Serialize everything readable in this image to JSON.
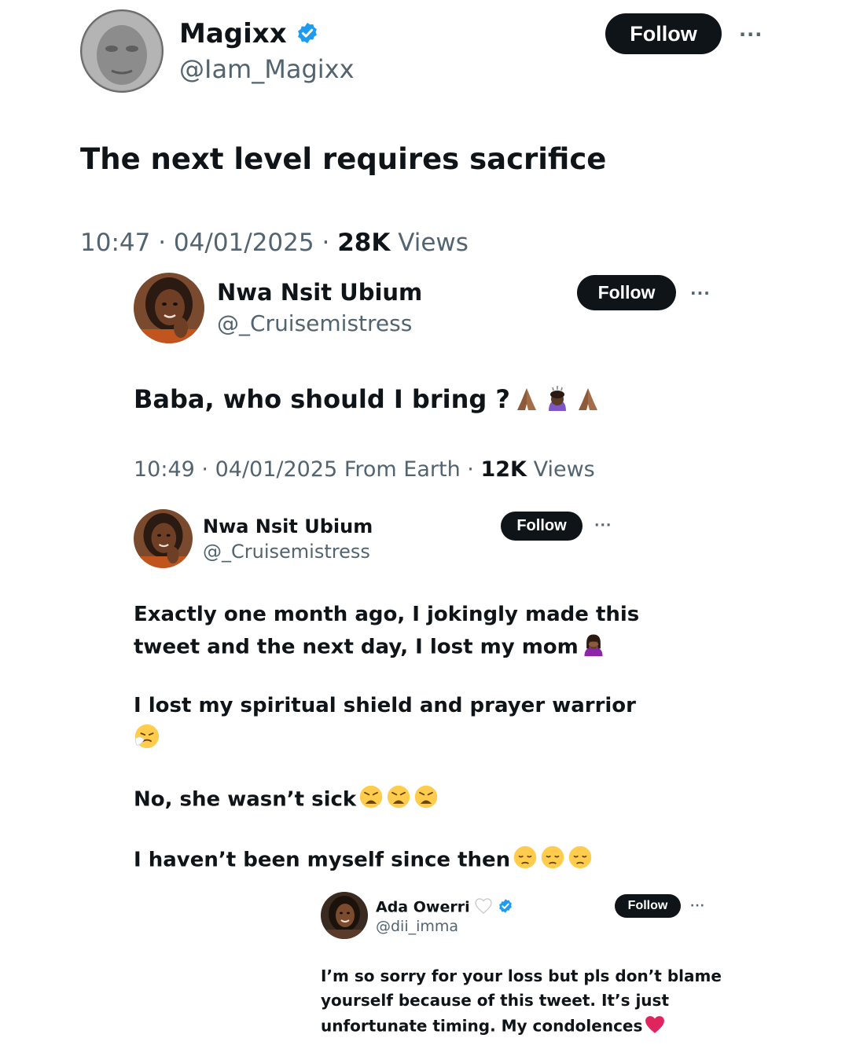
{
  "tweet_main": {
    "name": "Magixx",
    "handle": "@Iam_Magixx",
    "follow_label": "Follow",
    "more_label": "···",
    "text": "The next level requires sacrifice",
    "time": "10:47",
    "date": "04/01/2025",
    "views_count": "28K",
    "views_label": "Views",
    "separator": "·"
  },
  "reply_1": {
    "name": "Nwa Nsit Ubium",
    "handle": "@_Cruisemistress",
    "follow_label": "Follow",
    "more_label": "···",
    "text": "Baba, who should I bring ?",
    "emojis": [
      "folded-hands-icon",
      "person-bowing-icon",
      "folded-hands-icon"
    ],
    "time": "10:49",
    "date": "04/01/2025",
    "source": "From Earth",
    "views_count": "12K",
    "views_label": "Views",
    "separator": "·"
  },
  "reply_2": {
    "name": "Nwa Nsit Ubium",
    "handle": "@_Cruisemistress",
    "follow_label": "Follow",
    "more_label": "···",
    "line1": "Exactly one month ago, I jokingly made this",
    "line2": "tweet and the next day, I lost my mom",
    "line3": "I lost my spiritual shield and prayer warrior",
    "line4": "No, she wasn’t sick",
    "line5": "I haven’t been myself since then"
  },
  "reply_3": {
    "name": "Ada Owerri",
    "handle": "@dii_imma",
    "follow_label": "Follow",
    "more_label": "···",
    "line1": "I’m so sorry for your loss but pls don’t blame",
    "line2": "yourself because of this tweet. It’s just",
    "line3": "unfortunate timing. My condolences"
  },
  "colors": {
    "text": "#0f1419",
    "secondary": "#536471",
    "verified": "#1d9bf0",
    "button": "#0f1419",
    "heart": "#e0245e"
  }
}
